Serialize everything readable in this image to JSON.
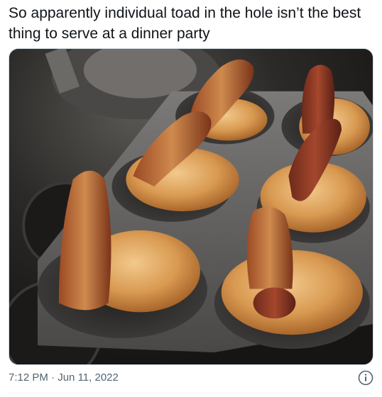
{
  "tweet": {
    "text": "So apparently individual toad in the hole isn’t the best thing to serve at a dinner party",
    "time": "7:12 PM",
    "separator": "·",
    "date": "Jun 11, 2022"
  },
  "icons": {
    "info": "info-icon"
  },
  "colors": {
    "text": "#0f1419",
    "secondary": "#536471",
    "divider": "#eff3f4"
  }
}
